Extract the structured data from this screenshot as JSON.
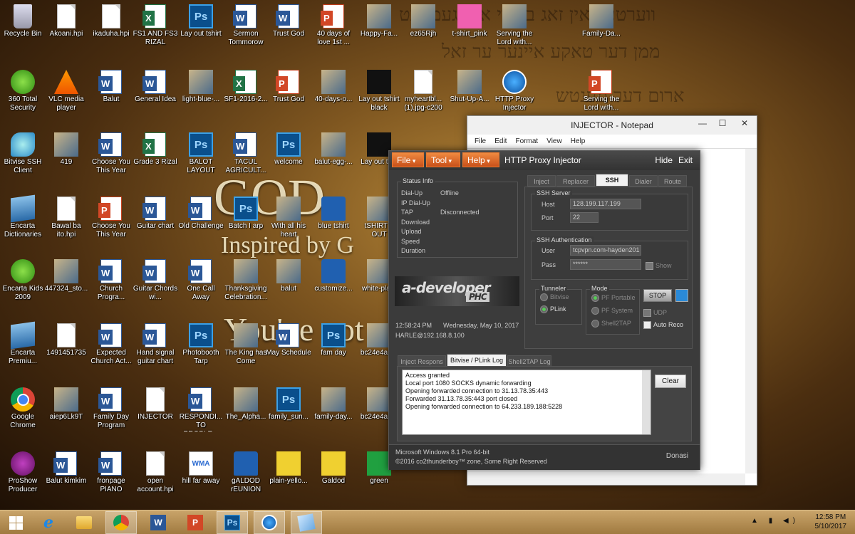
{
  "desktop": {
    "wallpaper_text": {
      "god": "GOD",
      "inspired": "Inspired by G",
      "youve": "You've got"
    },
    "icons": [
      {
        "label": "Recycle Bin",
        "type": "bin"
      },
      {
        "label": "Akoani.hpi",
        "type": "doc"
      },
      {
        "label": "ikaduha.hpi",
        "type": "doc"
      },
      {
        "label": "FS1 AND FS3 RIZAL",
        "type": "excel"
      },
      {
        "label": "Lay out tshirt",
        "type": "ps"
      },
      {
        "label": "Sermon Tommorow",
        "type": "word"
      },
      {
        "label": "Trust God",
        "type": "word"
      },
      {
        "label": "40 days of love 1st ...",
        "type": "pp"
      },
      {
        "label": "Happy-Fa...",
        "type": "img"
      },
      {
        "label": "ez65Rjh",
        "type": "img"
      },
      {
        "label": "t-shirt_pink",
        "type": "shirt-pink"
      },
      {
        "label": "Serving the Lord with...",
        "type": "img"
      },
      {
        "label": "Family-Da...",
        "type": "img"
      },
      {
        "label": "360 Total Security",
        "type": "app-green"
      },
      {
        "label": "VLC media player",
        "type": "vlc"
      },
      {
        "label": "Balut",
        "type": "word"
      },
      {
        "label": "General Idea",
        "type": "word"
      },
      {
        "label": "light-blue-...",
        "type": "img"
      },
      {
        "label": "SF1-2016-2...",
        "type": "excel"
      },
      {
        "label": "Trust God",
        "type": "pp"
      },
      {
        "label": "40-days-o...",
        "type": "img"
      },
      {
        "label": "Lay out tshirt black",
        "type": "shirt-black"
      },
      {
        "label": "myheartbl... (1).jpg-c200",
        "type": "doc"
      },
      {
        "label": "Shut-Up-A...",
        "type": "img"
      },
      {
        "label": "HTTP Proxy Injector",
        "type": "blue-circle"
      },
      {
        "label": "Serving the Lord with...",
        "type": "pp"
      },
      {
        "label": "Bitvise SSH Client",
        "type": "swirl"
      },
      {
        "label": "419",
        "type": "img"
      },
      {
        "label": "Choose You This Year",
        "type": "word"
      },
      {
        "label": "Grade 3 Rizal",
        "type": "excel"
      },
      {
        "label": "BALOT LAYOUT",
        "type": "ps"
      },
      {
        "label": "TACUL AGRICULT...",
        "type": "word"
      },
      {
        "label": "welcome",
        "type": "ps"
      },
      {
        "label": "balut-egg-...",
        "type": "img"
      },
      {
        "label": "Lay out ts...",
        "type": "shirt-black"
      },
      {
        "label": "Encarta Dictionaries",
        "type": "book"
      },
      {
        "label": "Bawal ba ito.hpi",
        "type": "doc"
      },
      {
        "label": "Choose You This Year",
        "type": "pp"
      },
      {
        "label": "Guitar chart",
        "type": "word"
      },
      {
        "label": "Old Challenge",
        "type": "word"
      },
      {
        "label": "Batch I arp",
        "type": "ps"
      },
      {
        "label": "With all his heart",
        "type": "img"
      },
      {
        "label": "blue tshirt",
        "type": "shirt-blue"
      },
      {
        "label": "tSHIRT L OUT",
        "type": "img"
      },
      {
        "label": "Encarta Kids 2009",
        "type": "app-green"
      },
      {
        "label": "447324_sto...",
        "type": "img"
      },
      {
        "label": "Church Progra...",
        "type": "word"
      },
      {
        "label": "Guitar Chords wi...",
        "type": "word"
      },
      {
        "label": "One Call Away",
        "type": "word"
      },
      {
        "label": "Thanksgiving Celebration...",
        "type": "img"
      },
      {
        "label": "balut",
        "type": "img"
      },
      {
        "label": "customize...",
        "type": "shirt-blue"
      },
      {
        "label": "white-pla...",
        "type": "img"
      },
      {
        "label": "Encarta Premiu...",
        "type": "book"
      },
      {
        "label": "1491451735",
        "type": "doc"
      },
      {
        "label": "Expected Church Act...",
        "type": "word"
      },
      {
        "label": "Hand signal guitar chart",
        "type": "word"
      },
      {
        "label": "Photobooth Tarp",
        "type": "ps"
      },
      {
        "label": "The King has Come",
        "type": "img"
      },
      {
        "label": "May Schedule",
        "type": "word"
      },
      {
        "label": "fam day",
        "type": "ps"
      },
      {
        "label": "bc24e4a1...",
        "type": "img"
      },
      {
        "label": "Google Chrome",
        "type": "chrome"
      },
      {
        "label": "aiep6Lk9T",
        "type": "img"
      },
      {
        "label": "Family Day Program",
        "type": "word"
      },
      {
        "label": "INJECTOR",
        "type": "doc"
      },
      {
        "label": "RESPONDI... TO PROBLE...",
        "type": "word"
      },
      {
        "label": "The_Alpha...",
        "type": "img"
      },
      {
        "label": "family_sun...",
        "type": "ps"
      },
      {
        "label": "family-day...",
        "type": "img"
      },
      {
        "label": "bc24e4a1...",
        "type": "img"
      },
      {
        "label": "ProShow Producer",
        "type": "pro"
      },
      {
        "label": "Balut kimkim",
        "type": "word"
      },
      {
        "label": "fronpage PIANO",
        "type": "word"
      },
      {
        "label": "open account.hpi",
        "type": "doc"
      },
      {
        "label": "hill far away",
        "type": "wma"
      },
      {
        "label": "gALDOD rEUNION",
        "type": "shirt-blue"
      },
      {
        "label": "plain-yello...",
        "type": "shirt-yellow"
      },
      {
        "label": "Galdod",
        "type": "shirt-yellow"
      },
      {
        "label": "green",
        "type": "shirt-green"
      }
    ]
  },
  "notepad": {
    "title": "INJECTOR - Notepad",
    "menu": [
      "File",
      "Edit",
      "Format",
      "View",
      "Help"
    ],
    "min": "—",
    "max": "☐",
    "close": "✕"
  },
  "injector": {
    "menus": [
      "File",
      "Tool",
      "Help"
    ],
    "title": "HTTP Proxy Injector",
    "hide": "Hide",
    "exit": "Exit",
    "status": {
      "title": "Status Info",
      "rows": [
        {
          "key": "Dial-Up",
          "value": "Offline"
        },
        {
          "key": "IP Dial-Up",
          "value": ""
        },
        {
          "key": "TAP",
          "value": "Disconnected"
        },
        {
          "key": "Download",
          "value": ""
        },
        {
          "key": "Upload",
          "value": ""
        },
        {
          "key": "Speed",
          "value": ""
        },
        {
          "key": "Duration",
          "value": ""
        }
      ]
    },
    "logo_text": "a-developer",
    "logo_sub": "PHC",
    "time": "12:58:24 PM",
    "date": "Wednesday, May 10, 2017",
    "host_line": "HARLE@192.168.8.100",
    "tabs": [
      "Inject",
      "Replacer",
      "SSH",
      "Dialer",
      "Route"
    ],
    "active_tab": "SSH",
    "ssh_server": {
      "title": "SSH Server",
      "host_label": "Host",
      "host": "128.199.117.199",
      "port_label": "Port",
      "port": "22"
    },
    "ssh_auth": {
      "title": "SSH Authentication",
      "user_label": "User",
      "user": "tcpvpn.com-hayden201",
      "pass_label": "Pass",
      "pass": "******",
      "show": "Show"
    },
    "tunneler": {
      "title": "Tunneler",
      "options": [
        "Bitvise",
        "PLink"
      ],
      "selected": "PLink"
    },
    "mode": {
      "title": "Mode",
      "options": [
        "PF Portable",
        "PF System",
        "Shell2TAP"
      ],
      "selected": "PF Portable"
    },
    "udp": "UDP",
    "auto_reco": "Auto Reco",
    "stop": "STOP",
    "log_tabs": [
      "Inject Respons",
      "Bitvise / PLink Log",
      "Shell2TAP Log"
    ],
    "active_log_tab": "Bitvise / PLink Log",
    "log_lines": [
      "Access granted",
      "Local port 1080 SOCKS dynamic forwarding",
      "Opening forwarded connection to 31.13.78.35:443",
      "Forwarded 31.13.78.35:443 port closed",
      "Opening forwarded connection to 64.233.189.188:5228"
    ],
    "clear": "Clear",
    "footer_os": "Microsoft Windows 8.1 Pro 64-bit",
    "footer_copy": "©2016 co2thunderboy™ zone, Some Right Reserved",
    "footer_donate": "Donasi"
  },
  "taskbar": {
    "items": [
      "start",
      "internet-explorer",
      "file-explorer",
      "chrome",
      "word",
      "powerpoint",
      "photoshop",
      "proxy-injector",
      "notepad"
    ],
    "active": [
      "chrome",
      "photoshop",
      "proxy-injector",
      "notepad"
    ],
    "tray": "▲ ▮ ◀)",
    "time": "12:58 PM",
    "date": "5/10/2017"
  }
}
